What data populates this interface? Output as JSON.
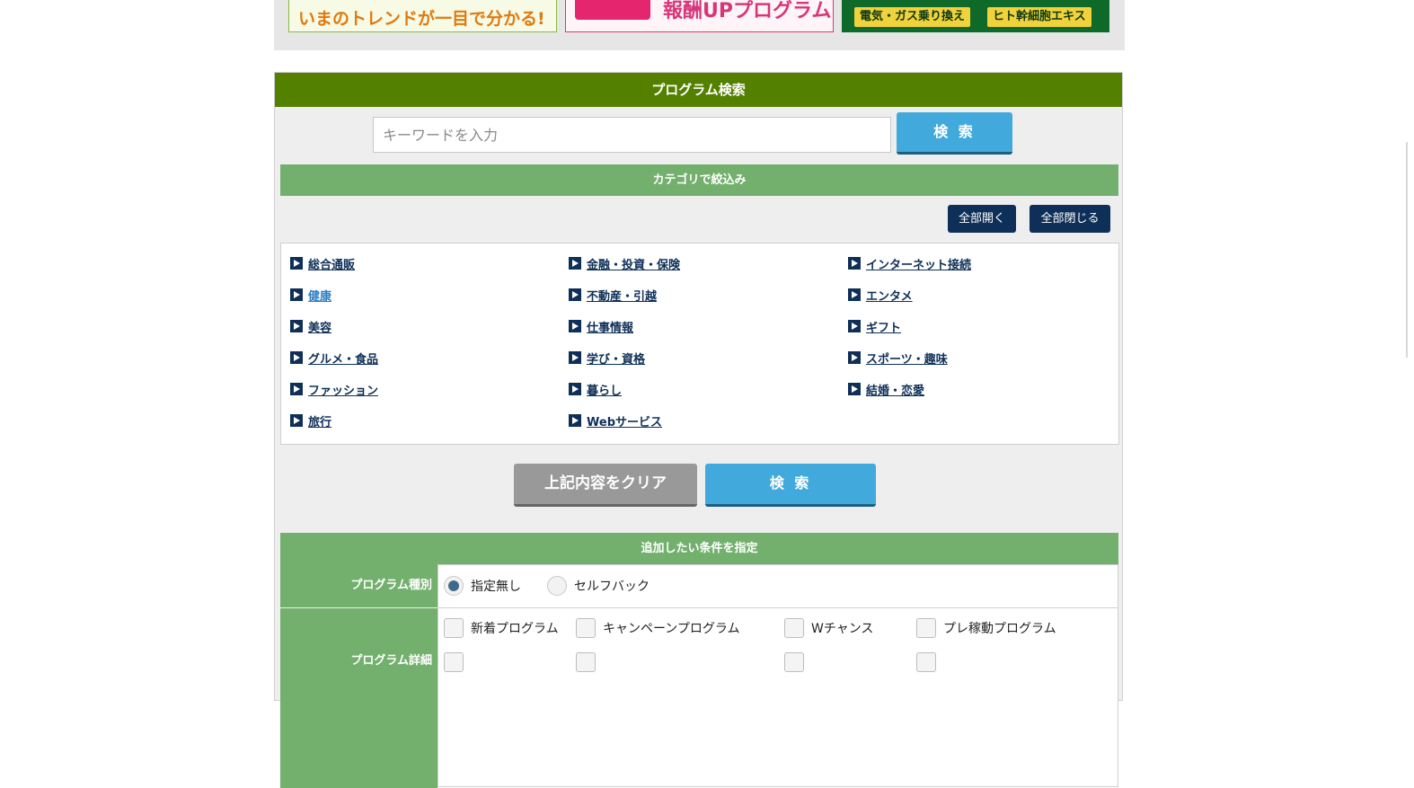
{
  "banners": {
    "b1_text": "いまのトレンドが一目で分かる!",
    "b2_text": "報酬UPプログラム",
    "b3_tag1": "電気・ガス乗り換え",
    "b3_tag2": "ヒト幹細胞エキス"
  },
  "search": {
    "title": "プログラム検索",
    "placeholder": "キーワードを入力",
    "search_label": "検 索"
  },
  "category": {
    "bar_title": "カテゴリで絞込み",
    "open_all": "全部開く",
    "close_all": "全部閉じる",
    "items": [
      {
        "label": "総合通販"
      },
      {
        "label": "健康"
      },
      {
        "label": "美容"
      },
      {
        "label": "グルメ・食品"
      },
      {
        "label": "ファッション"
      },
      {
        "label": "旅行"
      },
      {
        "label": "金融・投資・保険"
      },
      {
        "label": "不動産・引越"
      },
      {
        "label": "仕事情報"
      },
      {
        "label": "学び・資格"
      },
      {
        "label": "暮らし"
      },
      {
        "label": "Webサービス"
      },
      {
        "label": "インターネット接続"
      },
      {
        "label": "エンタメ"
      },
      {
        "label": "ギフト"
      },
      {
        "label": "スポーツ・趣味"
      },
      {
        "label": "結婚・恋愛"
      }
    ]
  },
  "actions": {
    "clear_label": "上記内容をクリア",
    "search_label": "検 索"
  },
  "conditions": {
    "bar_title": "追加したい条件を指定",
    "program_type_label": "プログラム種別",
    "program_type_options": [
      "指定無し",
      "セルフバック"
    ],
    "program_type_selected": "指定無し",
    "program_detail_label": "プログラム詳細",
    "checkboxes_row1": [
      "新着プログラム",
      "キャンペーンプログラム",
      "Wチャンス",
      "プレ稼動プログラム"
    ]
  },
  "colors": {
    "header_green": "#548000",
    "section_green": "#73b06e",
    "search_blue": "#41a9dc",
    "navy": "#0e2f57"
  }
}
